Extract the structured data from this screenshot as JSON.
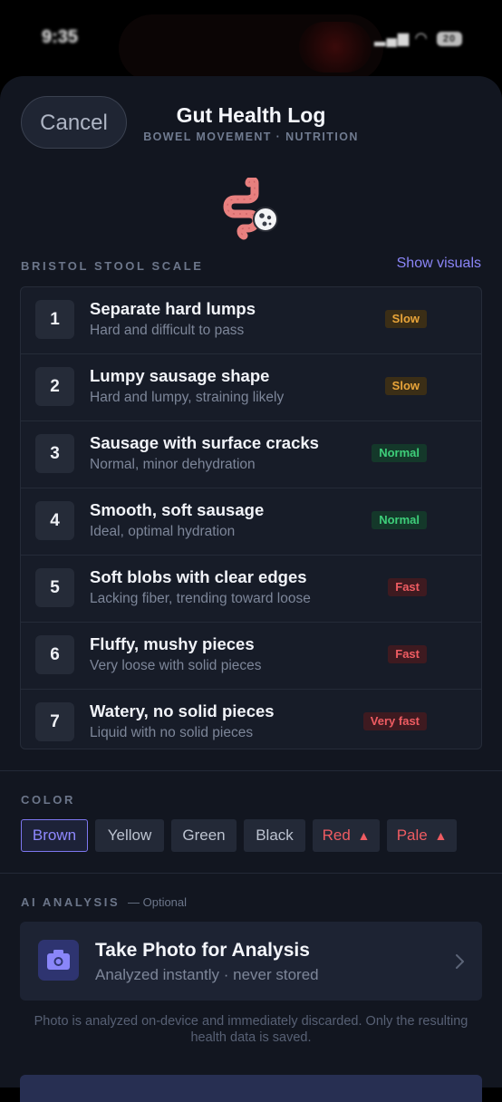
{
  "status_bar": {
    "time": "9:35",
    "battery": "20"
  },
  "header": {
    "cancel_label": "Cancel",
    "title": "Gut Health Log",
    "subtitle": "BOWEL MOVEMENT · NUTRITION",
    "icon": "intestine-icon"
  },
  "bristol": {
    "section_label": "BRISTOL STOOL SCALE",
    "show_visuals_label": "Show visuals",
    "rows": [
      {
        "number": "1",
        "title": "Separate hard lumps",
        "description": "Hard and difficult to pass",
        "badge": "Slow",
        "badge_color": "#e9a53a"
      },
      {
        "number": "2",
        "title": "Lumpy sausage shape",
        "description": "Hard and lumpy, straining likely",
        "badge": "Slow",
        "badge_color": "#e9a53a"
      },
      {
        "number": "3",
        "title": "Sausage with surface cracks",
        "description": "Normal, minor dehydration",
        "badge": "Normal",
        "badge_color": "#3ecf7a"
      },
      {
        "number": "4",
        "title": "Smooth, soft sausage",
        "description": "Ideal, optimal hydration",
        "badge": "Normal",
        "badge_color": "#3ecf7a"
      },
      {
        "number": "5",
        "title": "Soft blobs with clear edges",
        "description": "Lacking fiber, trending toward loose",
        "badge": "Fast",
        "badge_color": "#ef5c62"
      },
      {
        "number": "6",
        "title": "Fluffy, mushy pieces",
        "description": "Very loose with solid pieces",
        "badge": "Fast",
        "badge_color": "#ef5c62"
      },
      {
        "number": "7",
        "title": "Watery, no solid pieces",
        "description": "Liquid with no solid pieces",
        "badge": "Very fast",
        "badge_color": "#ef5c62"
      }
    ]
  },
  "color": {
    "section_label": "COLOR",
    "selected": "Brown",
    "options": [
      {
        "label": "Brown",
        "warning": false
      },
      {
        "label": "Yellow",
        "warning": false
      },
      {
        "label": "Green",
        "warning": false
      },
      {
        "label": "Black",
        "warning": false
      },
      {
        "label": "Red",
        "warning": true,
        "icon": "warning-icon"
      },
      {
        "label": "Pale",
        "warning": true,
        "icon": "warning-icon"
      }
    ]
  },
  "ai_analysis": {
    "section_label": "AI ANALYSIS",
    "optional_label": "— Optional",
    "card_title": "Take Photo for Analysis",
    "card_subtitle": "Analyzed instantly · never stored",
    "card_icon": "camera-icon",
    "disclaimer": "Photo is analyzed on-device and immediately discarded. Only the resulting health data is saved."
  },
  "colors": {
    "accent": "#8b85f7",
    "background": "#121620",
    "card": "#171c28"
  }
}
